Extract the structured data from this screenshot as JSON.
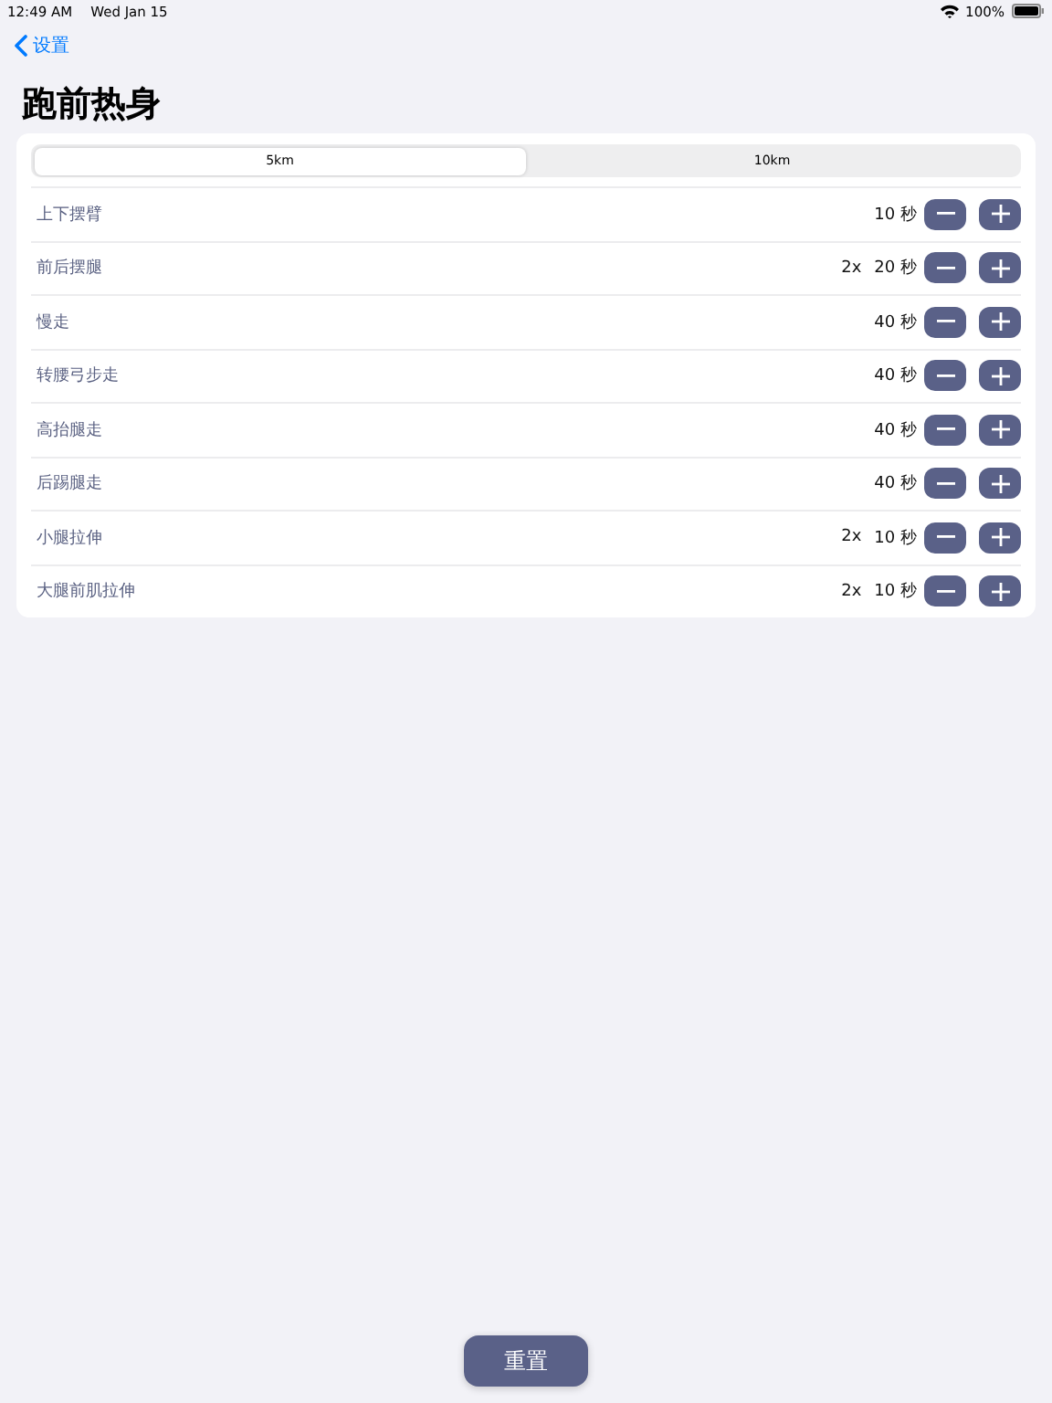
{
  "status_bar": {
    "time": "12:49 AM",
    "date": "Wed Jan 15",
    "battery": "100%"
  },
  "nav": {
    "back": "设置"
  },
  "title": "跑前热身",
  "segments": [
    {
      "label": "5km",
      "selected": true
    },
    {
      "label": "10km",
      "selected": false
    }
  ],
  "exercises": [
    {
      "name": "上下摆臂",
      "duration": "10 秒"
    },
    {
      "name": "前后摆腿",
      "reps": "2x",
      "duration": "20 秒"
    },
    {
      "name": "慢走",
      "duration": "40 秒"
    },
    {
      "name": "转腰弓步走",
      "duration": "40 秒"
    },
    {
      "name": "高抬腿走",
      "duration": "40 秒"
    },
    {
      "name": "后踢腿走",
      "duration": "40 秒"
    },
    {
      "name": "小腿拉伸",
      "reps": "2x",
      "duration": "10 秒"
    },
    {
      "name": "大腿前肌拉伸",
      "reps": "2x",
      "duration": "10 秒"
    }
  ],
  "reset_button": "重置"
}
